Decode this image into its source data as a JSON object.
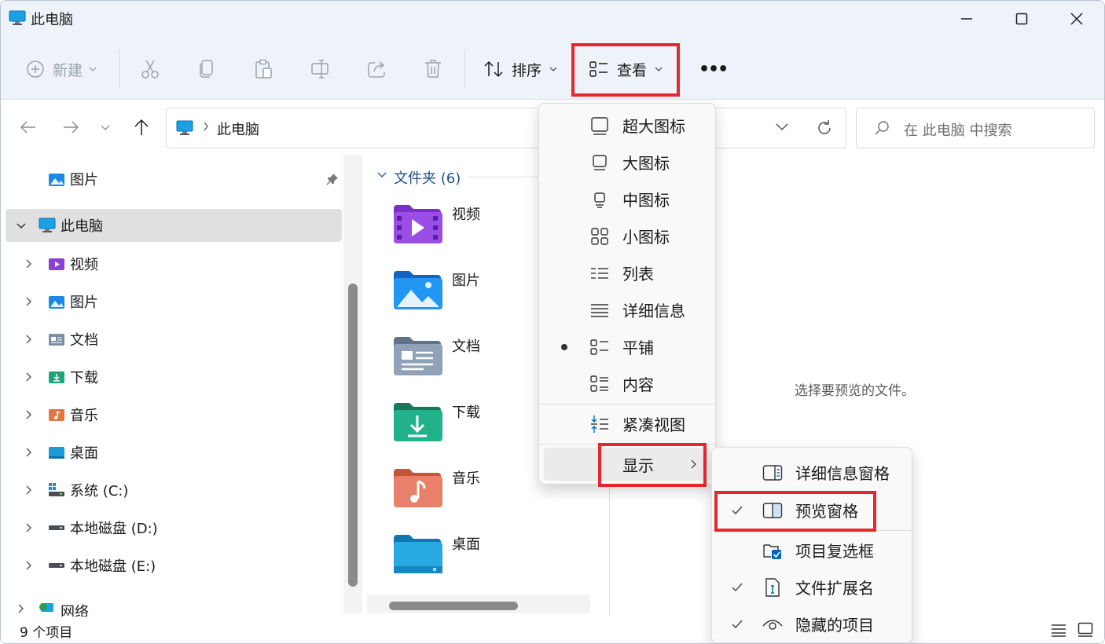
{
  "window": {
    "title": "此电脑"
  },
  "toolbar": {
    "new_label": "新建",
    "sort_label": "排序",
    "view_label": "查看",
    "more_label": "•••"
  },
  "address": {
    "location": "此电脑"
  },
  "search": {
    "placeholder": "在 此电脑 中搜索"
  },
  "nav": {
    "pinned": [
      {
        "label": "图片",
        "icon": "pictures-folder-icon"
      }
    ],
    "this_pc": "此电脑",
    "items": [
      {
        "label": "视频",
        "icon": "videos-folder-icon"
      },
      {
        "label": "图片",
        "icon": "pictures-folder-icon"
      },
      {
        "label": "文档",
        "icon": "documents-folder-icon"
      },
      {
        "label": "下载",
        "icon": "downloads-folder-icon"
      },
      {
        "label": "音乐",
        "icon": "music-folder-icon"
      },
      {
        "label": "桌面",
        "icon": "desktop-folder-icon"
      },
      {
        "label": "系统 (C:)",
        "icon": "windows-drive-icon"
      },
      {
        "label": "本地磁盘 (D:)",
        "icon": "drive-icon"
      },
      {
        "label": "本地磁盘 (E:)",
        "icon": "drive-icon"
      }
    ],
    "network": "网络"
  },
  "content": {
    "group_header": "文件夹 (6)",
    "folders": [
      {
        "label": "视频",
        "color": "#8b3fd6"
      },
      {
        "label": "图片",
        "color": "#1e88e5"
      },
      {
        "label": "文档",
        "color": "#7d8ea3"
      },
      {
        "label": "下载",
        "color": "#1ea37a"
      },
      {
        "label": "音乐",
        "color": "#e0764a"
      },
      {
        "label": "桌面",
        "color": "#1a9bd7"
      }
    ]
  },
  "preview": {
    "message": "选择要预览的文件。"
  },
  "status": {
    "items_count": "9 个项目"
  },
  "view_menu": {
    "items": [
      {
        "label": "超大图标",
        "icon": "extra-large-icons-icon",
        "selected": false
      },
      {
        "label": "大图标",
        "icon": "large-icons-icon",
        "selected": false
      },
      {
        "label": "中图标",
        "icon": "medium-icons-icon",
        "selected": false
      },
      {
        "label": "小图标",
        "icon": "small-icons-icon",
        "selected": false
      },
      {
        "label": "列表",
        "icon": "list-icon",
        "selected": false
      },
      {
        "label": "详细信息",
        "icon": "details-icon",
        "selected": false
      },
      {
        "label": "平铺",
        "icon": "tiles-icon",
        "selected": true
      },
      {
        "label": "内容",
        "icon": "content-icon",
        "selected": false
      }
    ],
    "compact": "紧凑视图",
    "show": "显示"
  },
  "show_menu": {
    "items": [
      {
        "label": "详细信息窗格",
        "icon": "details-pane-icon",
        "checked": false
      },
      {
        "label": "预览窗格",
        "icon": "preview-pane-icon",
        "checked": true
      },
      {
        "label": "项目复选框",
        "icon": "item-checkbox-icon",
        "checked": false
      },
      {
        "label": "文件扩展名",
        "icon": "file-extension-icon",
        "checked": true
      },
      {
        "label": "隐藏的项目",
        "icon": "hidden-items-icon",
        "checked": true
      }
    ]
  },
  "colors": {
    "highlight": "#e8262d",
    "accent": "#0067c0"
  }
}
